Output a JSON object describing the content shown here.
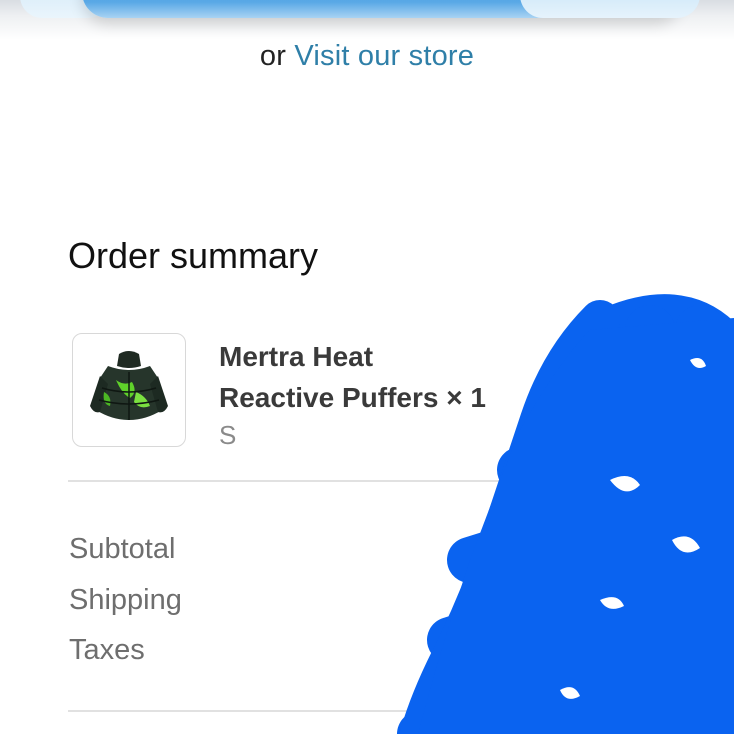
{
  "store_link": {
    "prefix": "or",
    "link_text": "Visit our store"
  },
  "order_summary": {
    "title": "Order summary",
    "item": {
      "name_line1": "Mertra Heat",
      "name_line2": "Reactive Puffers × 1",
      "variant": "S",
      "image_icon": "puffer-jacket-thumbnail"
    },
    "costs": [
      {
        "label": "Subtotal"
      },
      {
        "label": "Shipping"
      },
      {
        "label": "Taxes"
      }
    ]
  },
  "colors": {
    "link": "#2f7fa8",
    "scribble": "#0a63f0",
    "pay_button": "#4a9fe2"
  }
}
